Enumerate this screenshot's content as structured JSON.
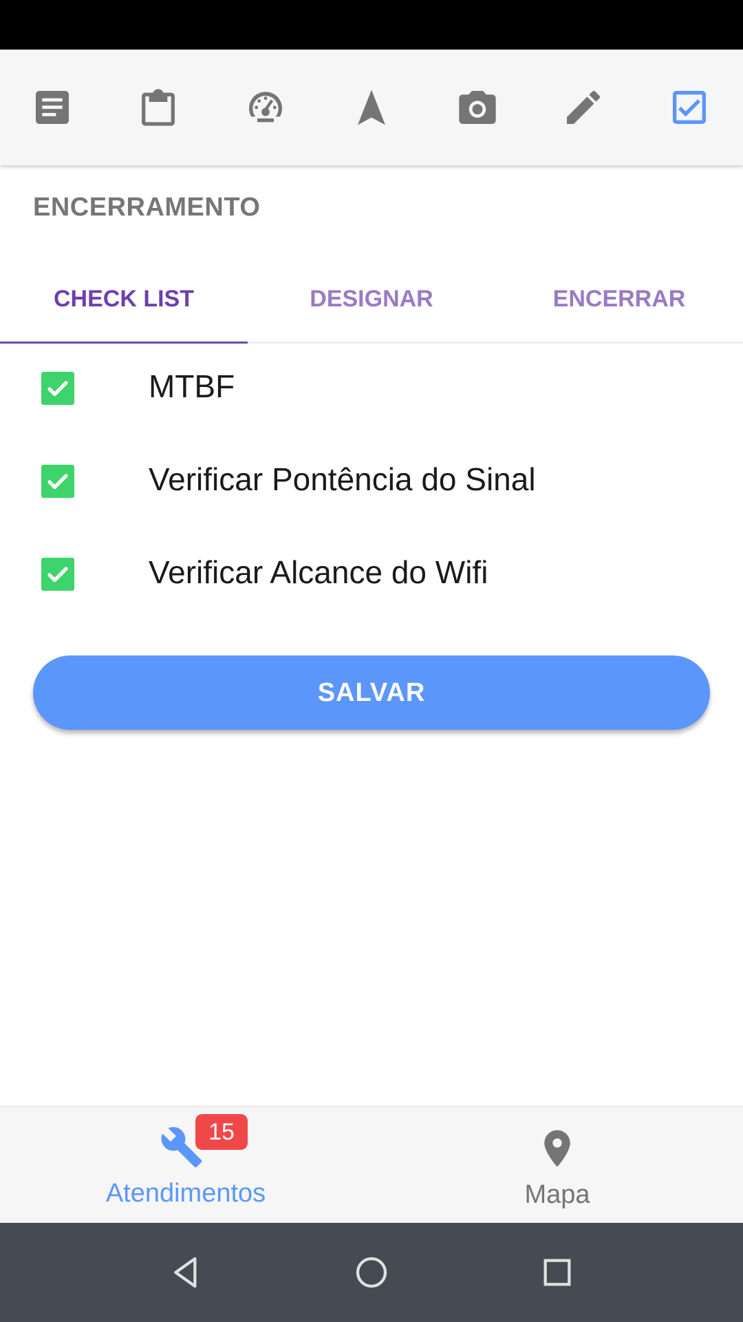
{
  "toolbar": {
    "icons": [
      "notes-icon",
      "clipboard-icon",
      "speedometer-icon",
      "navigation-icon",
      "camera-icon",
      "pencil-icon",
      "checkbox-icon"
    ],
    "active_icon": "checkbox-icon",
    "active_color": "#5b96fb",
    "inactive_color": "#757575"
  },
  "section": {
    "title": "ENCERRAMENTO"
  },
  "tabs": [
    {
      "label": "CHECK LIST",
      "active": true
    },
    {
      "label": "DESIGNAR",
      "active": false
    },
    {
      "label": "ENCERRAR",
      "active": false
    }
  ],
  "checklist": {
    "items": [
      {
        "label": "MTBF",
        "checked": true
      },
      {
        "label": "Verificar Pontência do Sinal",
        "checked": true
      },
      {
        "label": "Verificar Alcance do Wifi",
        "checked": true
      }
    ],
    "checkbox_color": "#3ed46b"
  },
  "save_button": {
    "label": "SALVAR",
    "color": "#5b96fb"
  },
  "bottom_nav": {
    "items": [
      {
        "label": "Atendimentos",
        "icon": "tools-icon",
        "active": true,
        "badge": "15"
      },
      {
        "label": "Mapa",
        "icon": "map-pin-icon",
        "active": false
      }
    ],
    "active_color": "#5b96fb",
    "inactive_color": "#757575",
    "badge_color": "#f04848"
  },
  "system_nav": {
    "buttons": [
      "back-icon",
      "home-icon",
      "recents-icon"
    ]
  }
}
